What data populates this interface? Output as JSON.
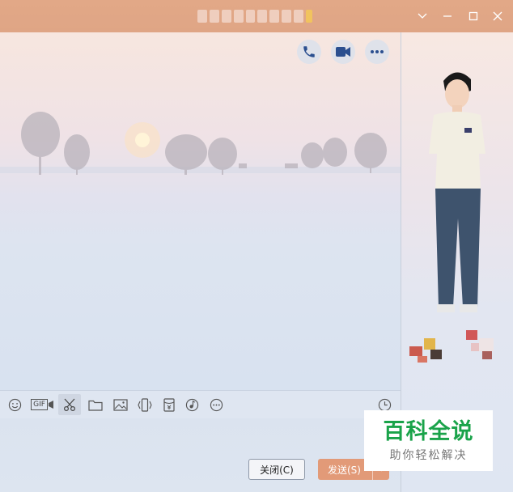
{
  "window": {
    "title_obscured": true,
    "controls": {
      "menu_icon": "chevron-down-icon",
      "minimize_icon": "minimize-icon",
      "maximize_icon": "maximize-icon",
      "close_icon": "close-icon"
    }
  },
  "header_actions": [
    {
      "name": "voice-call-button",
      "icon": "phone-icon"
    },
    {
      "name": "video-call-button",
      "icon": "video-camera-icon"
    },
    {
      "name": "more-button",
      "icon": "more-dots-icon"
    }
  ],
  "colors": {
    "titlebar": "#e2a887",
    "accent_icon": "#2b4f8f",
    "send_button": "#e29a78",
    "watermark_green": "#1aa34a"
  },
  "toolbar": {
    "items": [
      {
        "name": "emoji-icon"
      },
      {
        "name": "gif-icon",
        "label": "GIF"
      },
      {
        "name": "scissors-icon",
        "active": true
      },
      {
        "name": "folder-icon"
      },
      {
        "name": "image-icon"
      },
      {
        "name": "shake-icon"
      },
      {
        "name": "red-packet-icon"
      },
      {
        "name": "music-icon"
      },
      {
        "name": "more-circle-icon"
      },
      {
        "name": "history-clock-icon"
      }
    ]
  },
  "buttons": {
    "close_label": "关闭(C)",
    "send_label": "发送(S)"
  },
  "watermark": {
    "title": "百科全说",
    "subtitle": "助你轻松解决"
  }
}
